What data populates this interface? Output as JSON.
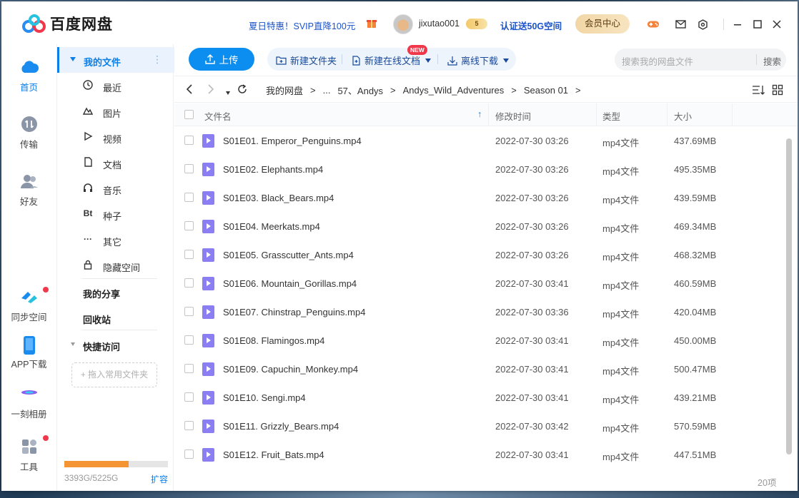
{
  "app": {
    "name": "百度网盘",
    "accent": "#0b7ee8"
  },
  "header": {
    "promo": "夏日特惠！SVIP直降100元",
    "username": "jixutao001",
    "vip_level": "5",
    "verify": "认证送50G空间",
    "member_button": "会员中心",
    "icons": [
      "game-icon",
      "mail-icon",
      "settings-icon",
      "minimize-icon",
      "maximize-icon",
      "close-icon"
    ]
  },
  "leftnav": {
    "items": [
      {
        "label": "首页",
        "icon": "cloud-icon"
      },
      {
        "label": "传输",
        "icon": "transfer-icon"
      },
      {
        "label": "好友",
        "icon": "friends-icon"
      },
      {
        "label": "同步空间",
        "icon": "sync-icon"
      },
      {
        "label": "APP下载",
        "icon": "phone-icon"
      },
      {
        "label": "一刻相册",
        "icon": "album-icon"
      },
      {
        "label": "工具",
        "icon": "tools-icon"
      }
    ]
  },
  "sidebar": {
    "my_files": "我的文件",
    "items": [
      {
        "label": "最近",
        "icon": "clock-icon"
      },
      {
        "label": "图片",
        "icon": "image-icon"
      },
      {
        "label": "视频",
        "icon": "play-icon"
      },
      {
        "label": "文档",
        "icon": "document-icon"
      },
      {
        "label": "音乐",
        "icon": "headphones-icon"
      },
      {
        "label": "种子",
        "icon": "bt-icon",
        "glyph": "Bt"
      },
      {
        "label": "其它",
        "icon": "more-icon",
        "glyph": "···"
      },
      {
        "label": "隐藏空间",
        "icon": "lock-icon"
      }
    ],
    "my_share": "我的分享",
    "recycle": "回收站",
    "quick_access": "快捷访问",
    "drop_hint": "+ 拖入常用文件夹",
    "quota": {
      "text": "3393G/5225G",
      "used": 3393,
      "total": 5225,
      "expand": "扩容"
    }
  },
  "toolbar": {
    "upload": "上传",
    "new_folder": "新建文件夹",
    "new_doc": "新建在线文档",
    "new_badge": "NEW",
    "offline_download": "离线下载",
    "search_placeholder": "搜索我的网盘文件",
    "search_button": "搜索"
  },
  "breadcrumb": {
    "items": [
      "我的网盘",
      "...",
      "57、Andys",
      "Andys_Wild_Adventures",
      "Season 01"
    ],
    "separator": ">"
  },
  "table": {
    "columns": {
      "name": "文件名",
      "modified": "修改时间",
      "type": "类型",
      "size": "大小"
    },
    "rows": [
      {
        "name": "S01E01. Emperor_Penguins.mp4",
        "modified": "2022-07-30 03:26",
        "type": "mp4文件",
        "size": "437.69MB"
      },
      {
        "name": "S01E02. Elephants.mp4",
        "modified": "2022-07-30 03:26",
        "type": "mp4文件",
        "size": "495.35MB"
      },
      {
        "name": "S01E03. Black_Bears.mp4",
        "modified": "2022-07-30 03:26",
        "type": "mp4文件",
        "size": "439.59MB"
      },
      {
        "name": "S01E04. Meerkats.mp4",
        "modified": "2022-07-30 03:26",
        "type": "mp4文件",
        "size": "469.34MB"
      },
      {
        "name": "S01E05. Grasscutter_Ants.mp4",
        "modified": "2022-07-30 03:26",
        "type": "mp4文件",
        "size": "468.32MB"
      },
      {
        "name": "S01E06. Mountain_Gorillas.mp4",
        "modified": "2022-07-30 03:41",
        "type": "mp4文件",
        "size": "460.59MB"
      },
      {
        "name": "S01E07. Chinstrap_Penguins.mp4",
        "modified": "2022-07-30 03:36",
        "type": "mp4文件",
        "size": "420.04MB"
      },
      {
        "name": "S01E08. Flamingos.mp4",
        "modified": "2022-07-30 03:41",
        "type": "mp4文件",
        "size": "450.00MB"
      },
      {
        "name": "S01E09. Capuchin_Monkey.mp4",
        "modified": "2022-07-30 03:41",
        "type": "mp4文件",
        "size": "500.47MB"
      },
      {
        "name": "S01E10. Sengi.mp4",
        "modified": "2022-07-30 03:41",
        "type": "mp4文件",
        "size": "439.21MB"
      },
      {
        "name": "S01E11. Grizzly_Bears.mp4",
        "modified": "2022-07-30 03:42",
        "type": "mp4文件",
        "size": "570.59MB"
      },
      {
        "name": "S01E12. Fruit_Bats.mp4",
        "modified": "2022-07-30 03:41",
        "type": "mp4文件",
        "size": "447.51MB"
      }
    ],
    "total": "20项"
  }
}
